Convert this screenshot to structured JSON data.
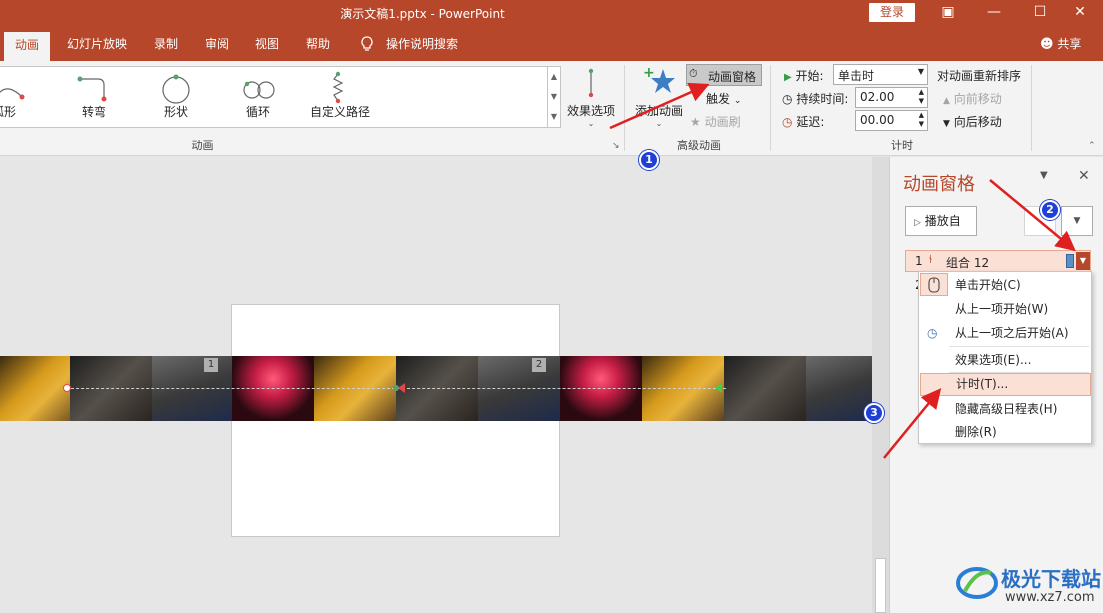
{
  "window": {
    "title": "演示文稿1.pptx  -  PowerPoint",
    "login_label": "登录",
    "share_label": "共享"
  },
  "tabs": [
    {
      "label": "动画",
      "active": true
    },
    {
      "label": "幻灯片放映"
    },
    {
      "label": "录制"
    },
    {
      "label": "审阅"
    },
    {
      "label": "视图"
    },
    {
      "label": "帮助"
    },
    {
      "label": "操作说明搜索",
      "icon": "lightbulb-icon"
    }
  ],
  "ribbon": {
    "gallery_items": [
      "弧形",
      "转弯",
      "形状",
      "循环",
      "自定义路径"
    ],
    "effect_options_label": "效果选项",
    "group_animation_label": "动画",
    "add_animation_label": "添加动画",
    "animation_pane_label": "动画窗格",
    "trigger_label": "触发",
    "animation_painter_label": "动画刷",
    "group_advanced_label": "高级动画",
    "start_label": "开始:",
    "start_value": "单击时",
    "duration_label": "持续时间:",
    "duration_value": "02.00",
    "delay_label": "延迟:",
    "delay_value": "00.00",
    "group_timing_label": "计时",
    "reorder_label": "对动画重新排序",
    "move_earlier_label": "向前移动",
    "move_later_label": "向后移动"
  },
  "filmstrip": {
    "frame_numbers": [
      "1",
      "2"
    ]
  },
  "pane": {
    "title": "动画窗格",
    "play_label": "播放自",
    "items": [
      {
        "index": "1",
        "label": "组合 12"
      },
      {
        "index": "2",
        "label": ""
      }
    ]
  },
  "context_menu": {
    "items": [
      {
        "label": "单击开始(C)",
        "icon": "mouse-icon"
      },
      {
        "label": "从上一项开始(W)"
      },
      {
        "label": "从上一项之后开始(A)",
        "icon": "clock-icon"
      },
      {
        "label": "效果选项(E)..."
      },
      {
        "label": "计时(T)...",
        "highlighted": true
      },
      {
        "label": "隐藏高级日程表(H)"
      },
      {
        "label": "删除(R)"
      }
    ]
  },
  "annotations": {
    "badges": [
      "1",
      "2",
      "3"
    ],
    "arrow_color": "#e02020"
  },
  "watermark": {
    "brand": "极光下载站",
    "url": "www.xz7.com"
  },
  "colors": {
    "accent": "#b7472a",
    "highlight": "#fbe0d6",
    "badge": "#1f3fd6"
  }
}
